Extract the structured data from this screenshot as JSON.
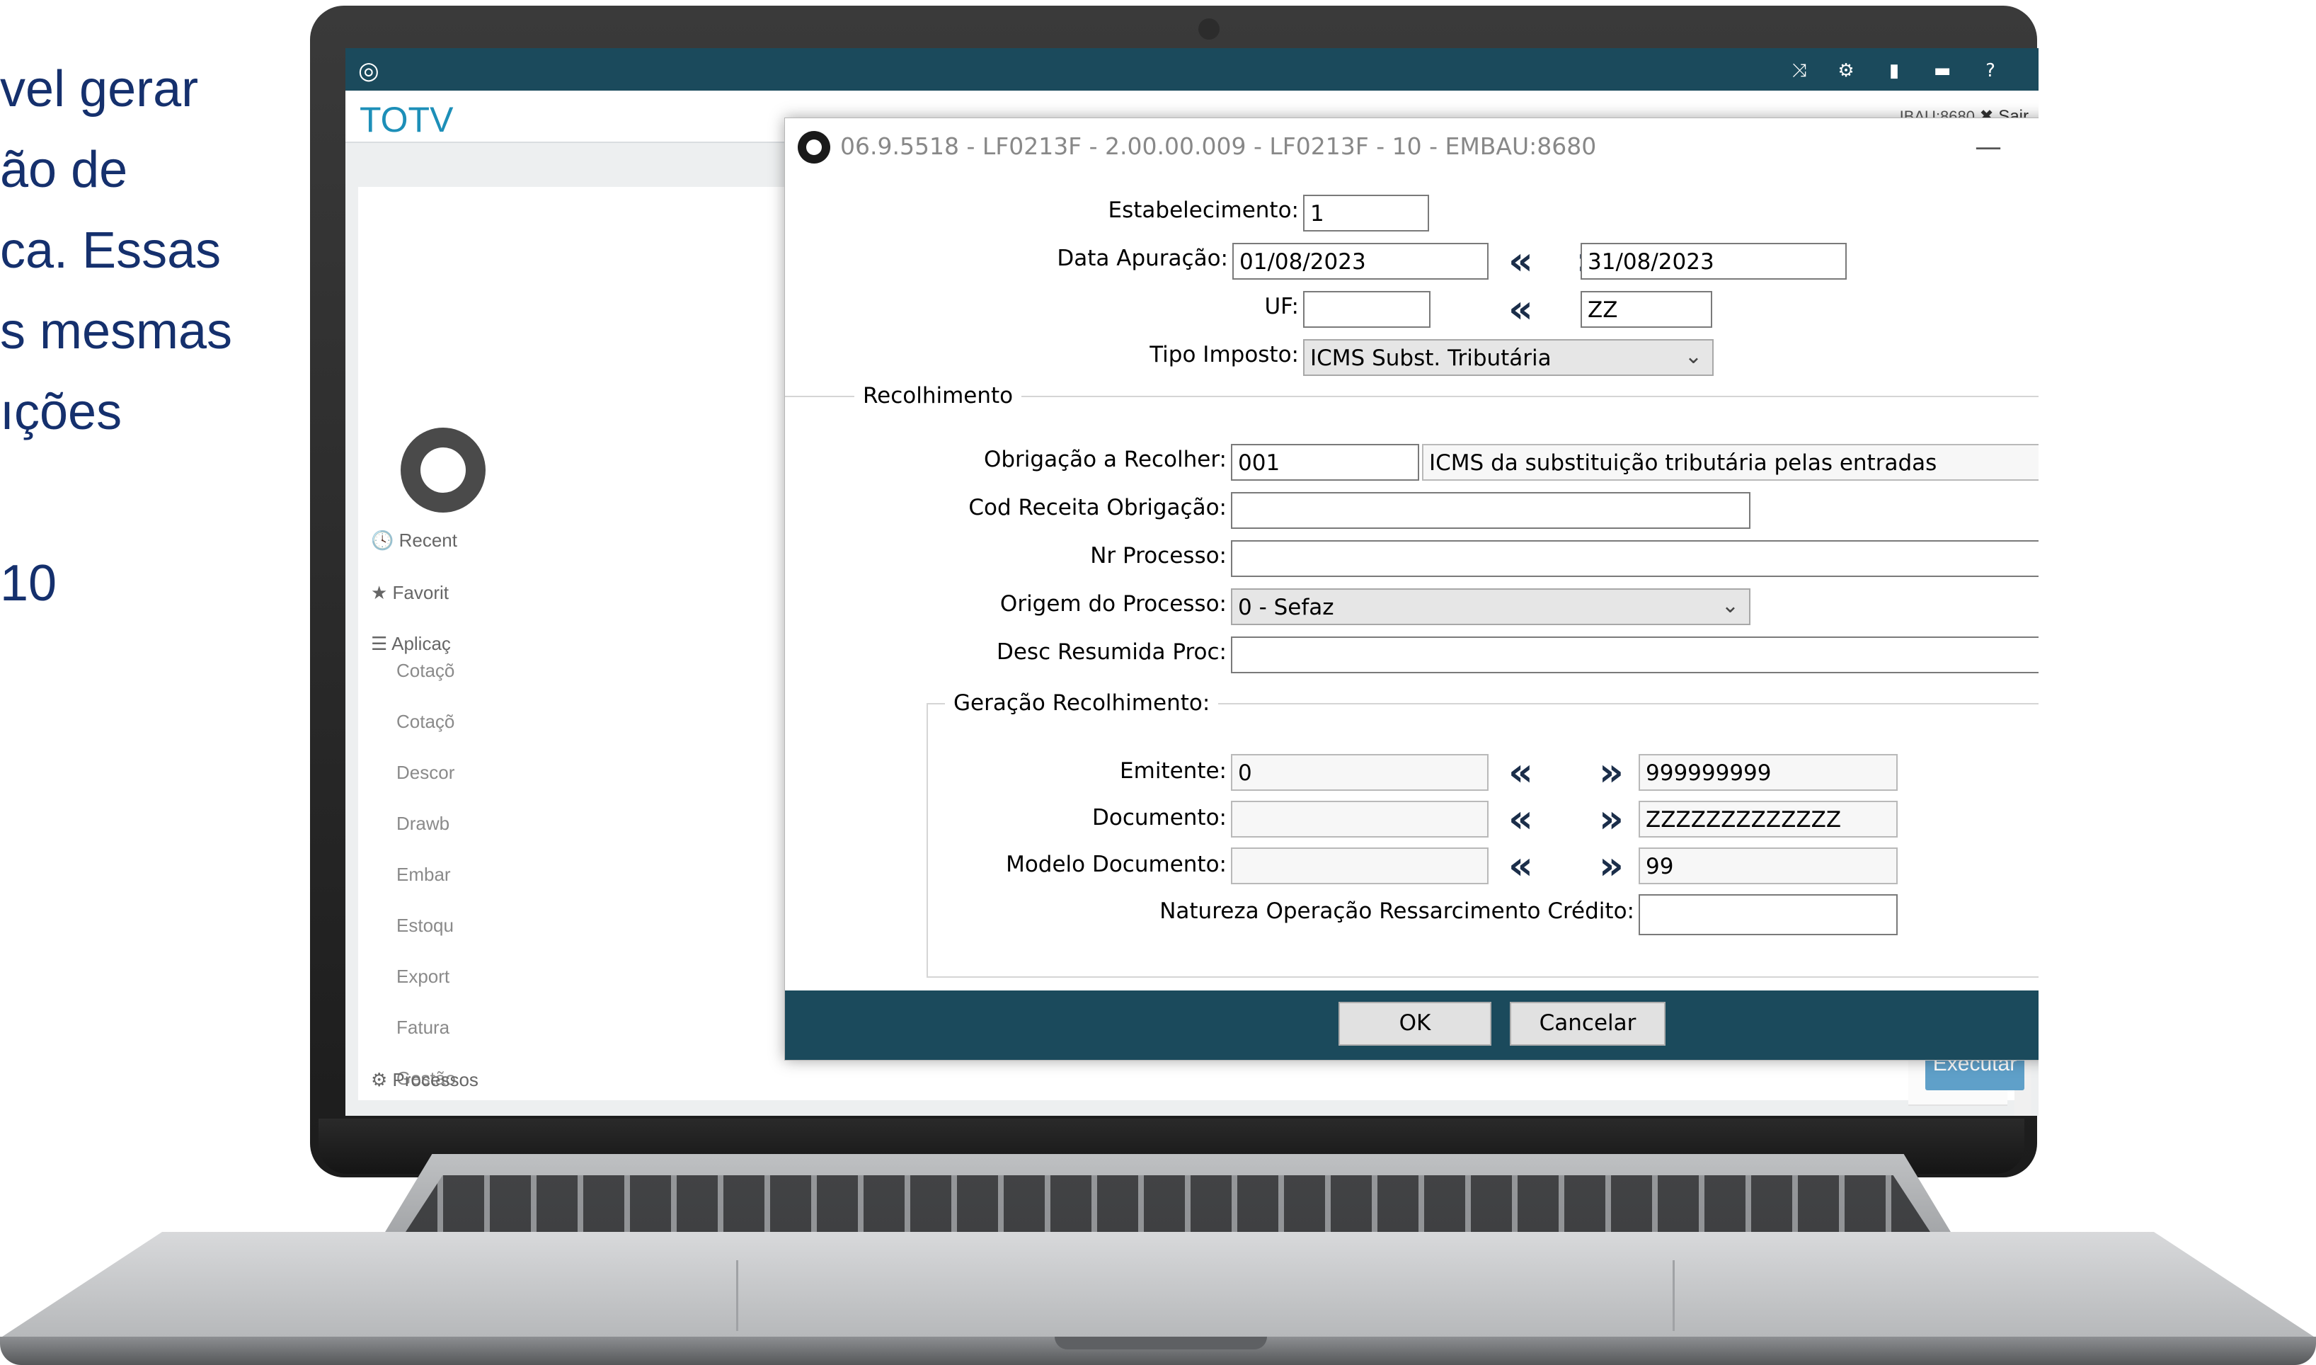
{
  "slide": {
    "lines": [
      "vel gerar",
      "ão de",
      "ca. Essas",
      "s mesmas",
      "ıções",
      "",
      "10"
    ]
  },
  "app": {
    "brand": "TOTV",
    "user_tag": "IBAU:8680",
    "logout": "✖ Sair",
    "menu": {
      "recent": "🕓 Recent",
      "favorites": "★ Favorit",
      "applications": "☰ Aplicaç",
      "items": [
        "Cotaçõ",
        "Cotaçõ",
        "Descor",
        "Drawb",
        "Embar",
        "Estoqu",
        "Export",
        "Fatura",
        "Gestão"
      ],
      "processes": "⚙ Processos"
    },
    "execute_label": "Executar",
    "top_icons": [
      "shuffle-icon",
      "gear-icon",
      "document-icon",
      "chat-icon",
      "help-icon"
    ]
  },
  "dialog": {
    "title": "06.9.5518 - LF0213F - 2.00.00.009 - LF0213F - 10 - EMBAU:8680",
    "controls": {
      "minimize": "—",
      "maximize": "☐",
      "close": "✕"
    },
    "fields": {
      "estabelecimento": {
        "label": "Estabelecimento:",
        "value": "1"
      },
      "data_apuracao": {
        "label": "Data Apuração:",
        "from": "01/08/2023",
        "to": "31/08/2023"
      },
      "uf": {
        "label": "UF:",
        "from": "",
        "to": "ZZ"
      },
      "tipo_imposto": {
        "label": "Tipo Imposto:",
        "value": "ICMS Subst. Tributária"
      }
    },
    "recolhimento": {
      "legend": "Recolhimento",
      "obrigacao": {
        "label": "Obrigação a Recolher:",
        "code": "001",
        "description": "ICMS da substituição tributária pelas entradas"
      },
      "cod_receita": {
        "label": "Cod Receita Obrigação:",
        "value": ""
      },
      "nr_processo": {
        "label": "Nr Processo:",
        "value": ""
      },
      "origem_processo": {
        "label": "Origem do Processo:",
        "value": "0 - Sefaz"
      },
      "desc_resumida": {
        "label": "Desc Resumida Proc:",
        "value": ""
      }
    },
    "geracao": {
      "legend": "Geração Recolhimento:",
      "emitente": {
        "label": "Emitente:",
        "from": "0",
        "to": "999999999"
      },
      "documento": {
        "label": "Documento:",
        "from": "",
        "to": "ZZZZZZZZZZZZZ"
      },
      "modelo": {
        "label": "Modelo Documento:",
        "from": "",
        "to": "99"
      },
      "natureza": {
        "label": "Natureza Operação Ressarcimento Crédito:",
        "value": ""
      }
    },
    "range_left": "«",
    "range_right": "»",
    "buttons": {
      "ok": "OK",
      "cancel": "Cancelar"
    }
  },
  "colors": {
    "accent": "#1b4a5c",
    "brand": "#1d8fb8",
    "slide_text": "#15306d",
    "execute": "#5fa0c9"
  }
}
